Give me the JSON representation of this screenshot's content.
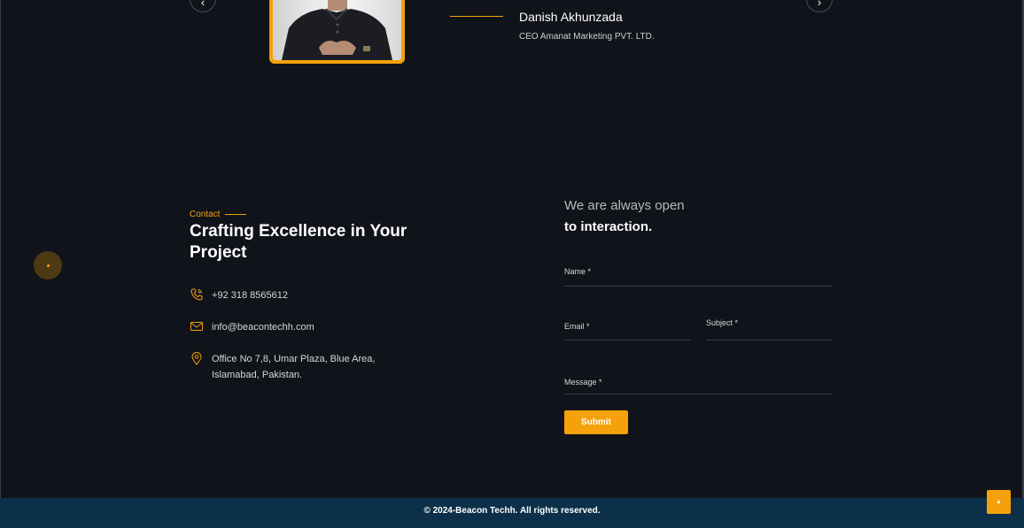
{
  "testimonial": {
    "prev_icon": "chevron-left-icon",
    "next_icon": "chevron-right-icon",
    "prev_glyph": "‹",
    "next_glyph": "›",
    "name": "Danish Akhunzada",
    "role": "CEO Amanat Marketing PVT. LTD."
  },
  "contact": {
    "tag": "Contact",
    "title": "Crafting Excellence in Your Project",
    "phone": "+92 318 8565612",
    "email": "info@beacontechh.com",
    "address": "Office No 7,8, Umar Plaza, Blue Area, Islamabad, Pakistan."
  },
  "form": {
    "heading_line1": "We are always open",
    "heading_line2": "to interaction.",
    "name_label": "Name *",
    "email_label": "Email *",
    "subject_label": "Subject *",
    "message_label": "Message *",
    "submit_label": "Submit"
  },
  "footer": {
    "copyright": "© 2024-Beacon Techh. All rights reserved.",
    "scroll_top_icon": "arrow-up-icon",
    "scroll_top_glyph": "▲"
  },
  "colors": {
    "background": "#11131a",
    "accent": "#f5a10a",
    "footer": "#0c3049"
  }
}
